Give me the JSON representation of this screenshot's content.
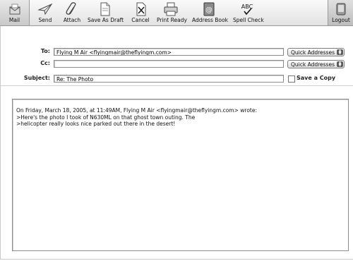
{
  "toolbar": {
    "mail": "Mail",
    "send": "Send",
    "attach": "Attach",
    "save_as_draft": "Save As Draft",
    "cancel": "Cancel",
    "print_ready": "Print Ready",
    "address_book": "Address Book",
    "spell_check": "Spell Check",
    "logout": "Logout"
  },
  "compose": {
    "to_label": "To:",
    "to_value": "Flying M Air <flyingmair@theflyingm.com>",
    "cc_label": "Cc:",
    "cc_value": "",
    "subject_label": "Subject:",
    "subject_value": "Re: The Photo",
    "quick_addresses": "Quick Addresses",
    "save_copy_label": "Save a Copy",
    "save_copy_checked": false,
    "body_lines": [
      "On Friday, March 18, 2005, at 11:49AM, Flying M Air <flyingmair@theflyingm.com> wrote:",
      "",
      ">Here's the photo I took of N630ML on that ghost town outing. The",
      ">helicopter really looks nice parked out there in the desert!"
    ]
  },
  "icons": [
    "mail-icon",
    "send-icon",
    "attach-icon",
    "save-draft-icon",
    "cancel-icon",
    "print-icon",
    "address-book-icon",
    "spell-check-icon",
    "logout-icon"
  ]
}
